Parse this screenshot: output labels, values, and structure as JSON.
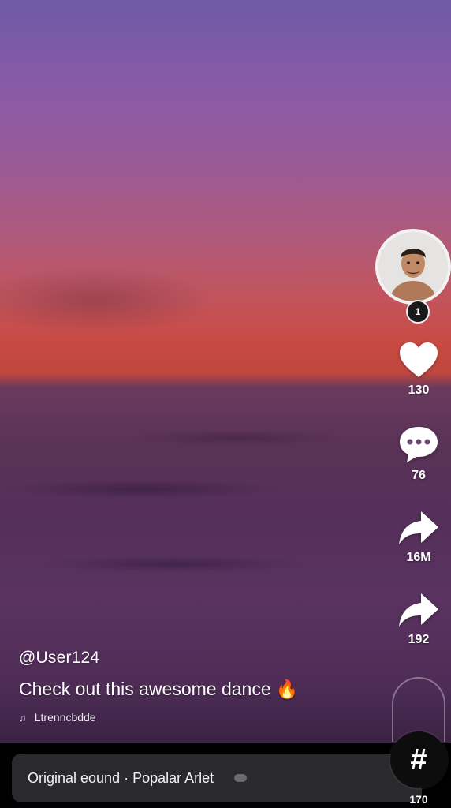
{
  "video": {
    "scene": "sunset-over-sea"
  },
  "creator": {
    "avatar_icon": "profile-photo",
    "follow_badge": "1"
  },
  "actions": {
    "likes": "130",
    "comments": "76",
    "shares": "16M",
    "reposts": "192"
  },
  "caption": {
    "username": "@User124",
    "text": "Check out this awesome dance",
    "emoji": "🔥",
    "music_icon": "music-note-icon",
    "music_text": "Ltrenncbdde"
  },
  "bottom": {
    "sound_label": "Original eound · Popalar Arlet",
    "hashtag_symbol": "#",
    "hashtag_count": "170"
  },
  "colors": {
    "sky_top": "#6e5aa6",
    "horizon": "#c84a42",
    "sea": "#55305a",
    "pill_bg": "#2a2a2e"
  }
}
